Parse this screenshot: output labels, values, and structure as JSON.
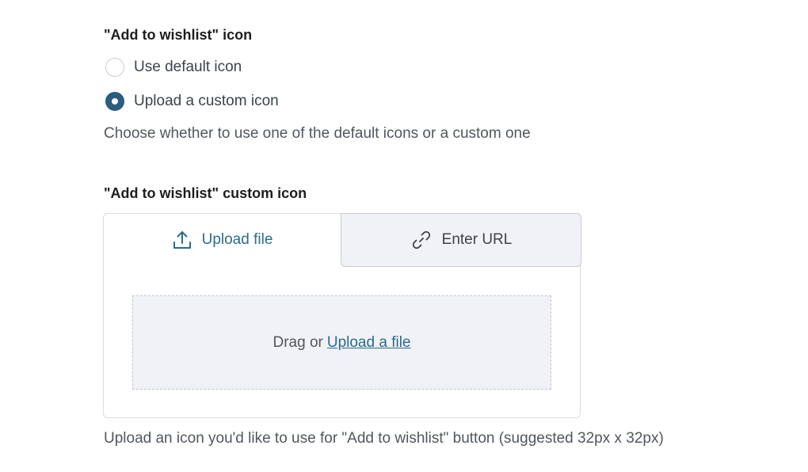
{
  "icon_setting": {
    "title": "\"Add to wishlist\" icon",
    "options": [
      {
        "label": "Use default icon",
        "checked": false
      },
      {
        "label": "Upload a custom icon",
        "checked": true
      }
    ],
    "help": "Choose whether to use one of the default icons or a custom one"
  },
  "custom_icon": {
    "title": "\"Add to wishlist\" custom icon",
    "tabs": [
      {
        "label": "Upload file",
        "icon": "upload-icon",
        "active": true
      },
      {
        "label": "Enter URL",
        "icon": "link-icon",
        "active": false
      }
    ],
    "dropzone": {
      "prefix": "Drag or",
      "link": "Upload a file"
    },
    "help": "Upload an icon you'd like to use for \"Add to wishlist\" button (suggested 32px x 32px)"
  },
  "colors": {
    "accent": "#2a5d80",
    "link": "#2a6b8f"
  }
}
